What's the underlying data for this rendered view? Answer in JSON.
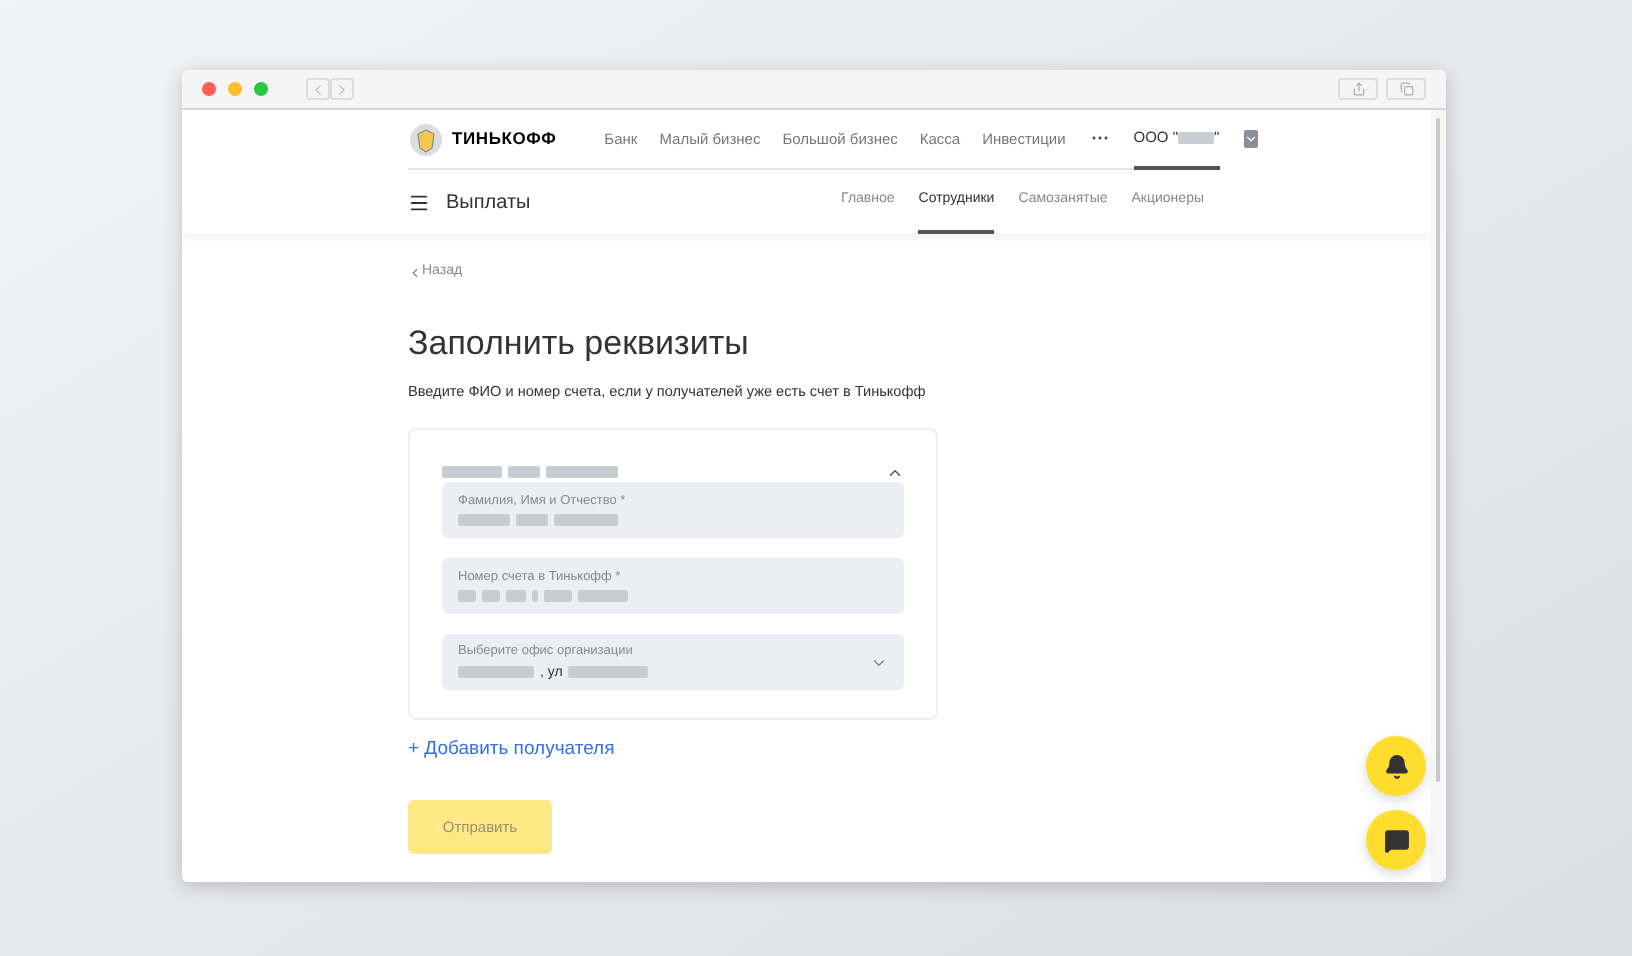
{
  "browser": {
    "back_disabled": true
  },
  "header": {
    "logo_text": "ТИНЬКОФФ",
    "nav": [
      "Банк",
      "Малый бизнес",
      "Большой бизнес",
      "Касса",
      "Инвестиции"
    ],
    "more": "···",
    "org": {
      "prefix": "ООО \"",
      "suffix": "\"",
      "selected": true
    }
  },
  "section": {
    "title": "Выплаты",
    "tabs": [
      {
        "label": "Главное",
        "selected": false
      },
      {
        "label": "Сотрудники",
        "selected": true
      },
      {
        "label": "Самозанятые",
        "selected": false
      },
      {
        "label": "Акционеры",
        "selected": false
      }
    ]
  },
  "back_link": "Назад",
  "heading": "Заполнить реквизиты",
  "subtitle": "Введите ФИО и номер счета, если у получателей уже есть счет в Тинькофф",
  "recipient": {
    "expanded": true,
    "fields": [
      {
        "kind": "text",
        "label": "Фамилия, Имя и Отчество *"
      },
      {
        "kind": "text",
        "label": "Номер счета в Тинькофф *"
      },
      {
        "kind": "select",
        "label": "Выберите офис организации",
        "value_text": ", ул"
      }
    ]
  },
  "add_link": "+ Добавить получателя",
  "submit": {
    "label": "Отправить",
    "disabled": true
  }
}
